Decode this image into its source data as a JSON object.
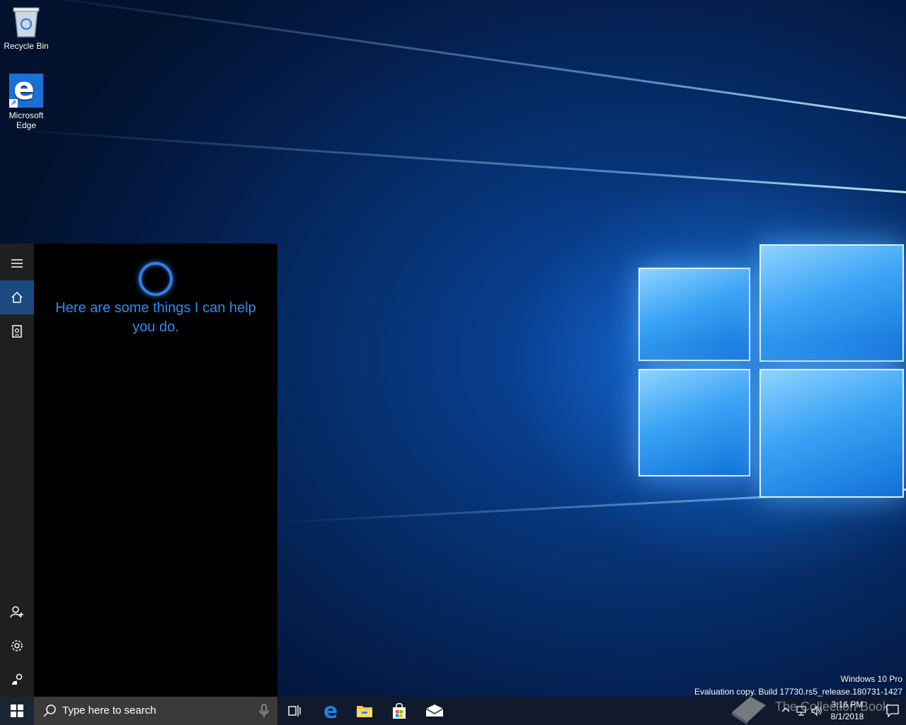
{
  "desktop": {
    "icons": [
      {
        "label": "Recycle Bin"
      },
      {
        "label": "Microsoft Edge"
      }
    ],
    "watermark": {
      "edition": "Windows 10 Pro",
      "build": "Evaluation copy. Build 17730.rs5_release.180731-1427"
    }
  },
  "cortana": {
    "message": "Here are some things I can help you do.",
    "rail_items": [
      "menu-icon",
      "home-icon",
      "notebook-icon",
      "add-account-icon",
      "gear-icon",
      "feedback-icon"
    ],
    "accent": "#2d8cf0"
  },
  "taskbar": {
    "search_placeholder": "Type here to search",
    "apps": [
      "task-view-icon",
      "edge-icon",
      "file-explorer-icon",
      "store-icon",
      "mail-icon"
    ],
    "clock": {
      "time": "3:16 PM",
      "date": "8/1/2018"
    },
    "overlay_watermark": "The Collection Book"
  }
}
